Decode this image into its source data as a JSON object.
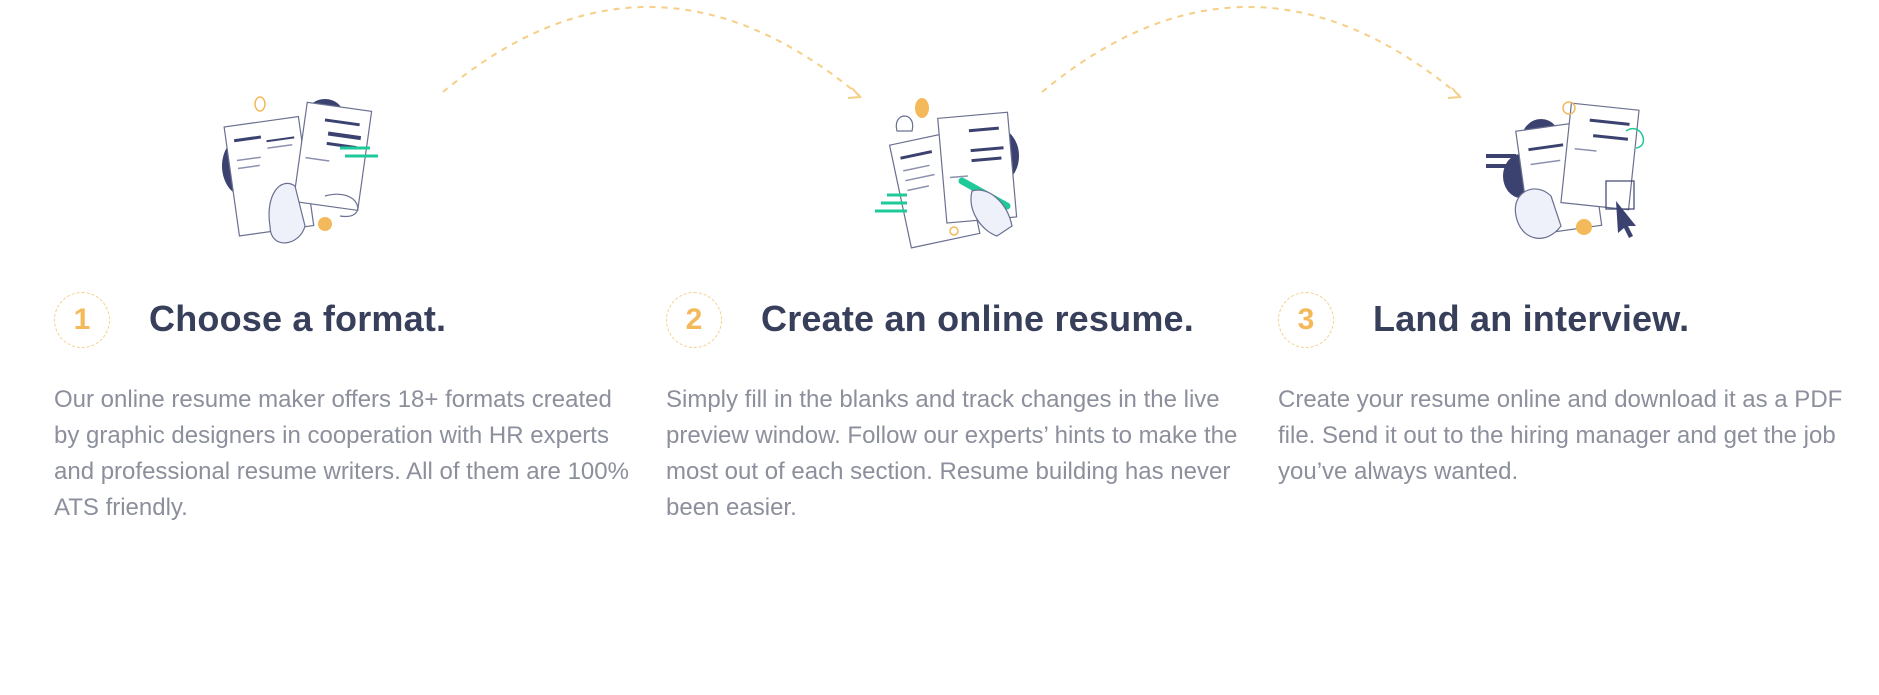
{
  "colors": {
    "accent": "#f3b95a",
    "accent_light": "#f5cf86",
    "heading": "#383f5b",
    "body_text": "#8c8f9c",
    "navy": "#3c4270",
    "green": "#1ec99a"
  },
  "steps": [
    {
      "number": "1",
      "title": "Choose a format.",
      "description": "Our online resume maker offers 18+ formats created by graphic designers in cooperation with HR experts and professional resume writers. All of them are 100% ATS friendly.",
      "illustration": "resume-templates-hand-icon"
    },
    {
      "number": "2",
      "title": "Create an online resume.",
      "description": "Simply fill in the blanks and track changes in the live preview window. Follow our experts’ hints to make the most out of each section. Resume building has never been easier.",
      "illustration": "resume-pen-writing-icon"
    },
    {
      "number": "3",
      "title": "Land an interview.",
      "description": "Create your resume online and download it as a PDF file. Send it out to the hiring manager and get the job you’ve always wanted.",
      "illustration": "resume-download-cursor-icon"
    }
  ]
}
